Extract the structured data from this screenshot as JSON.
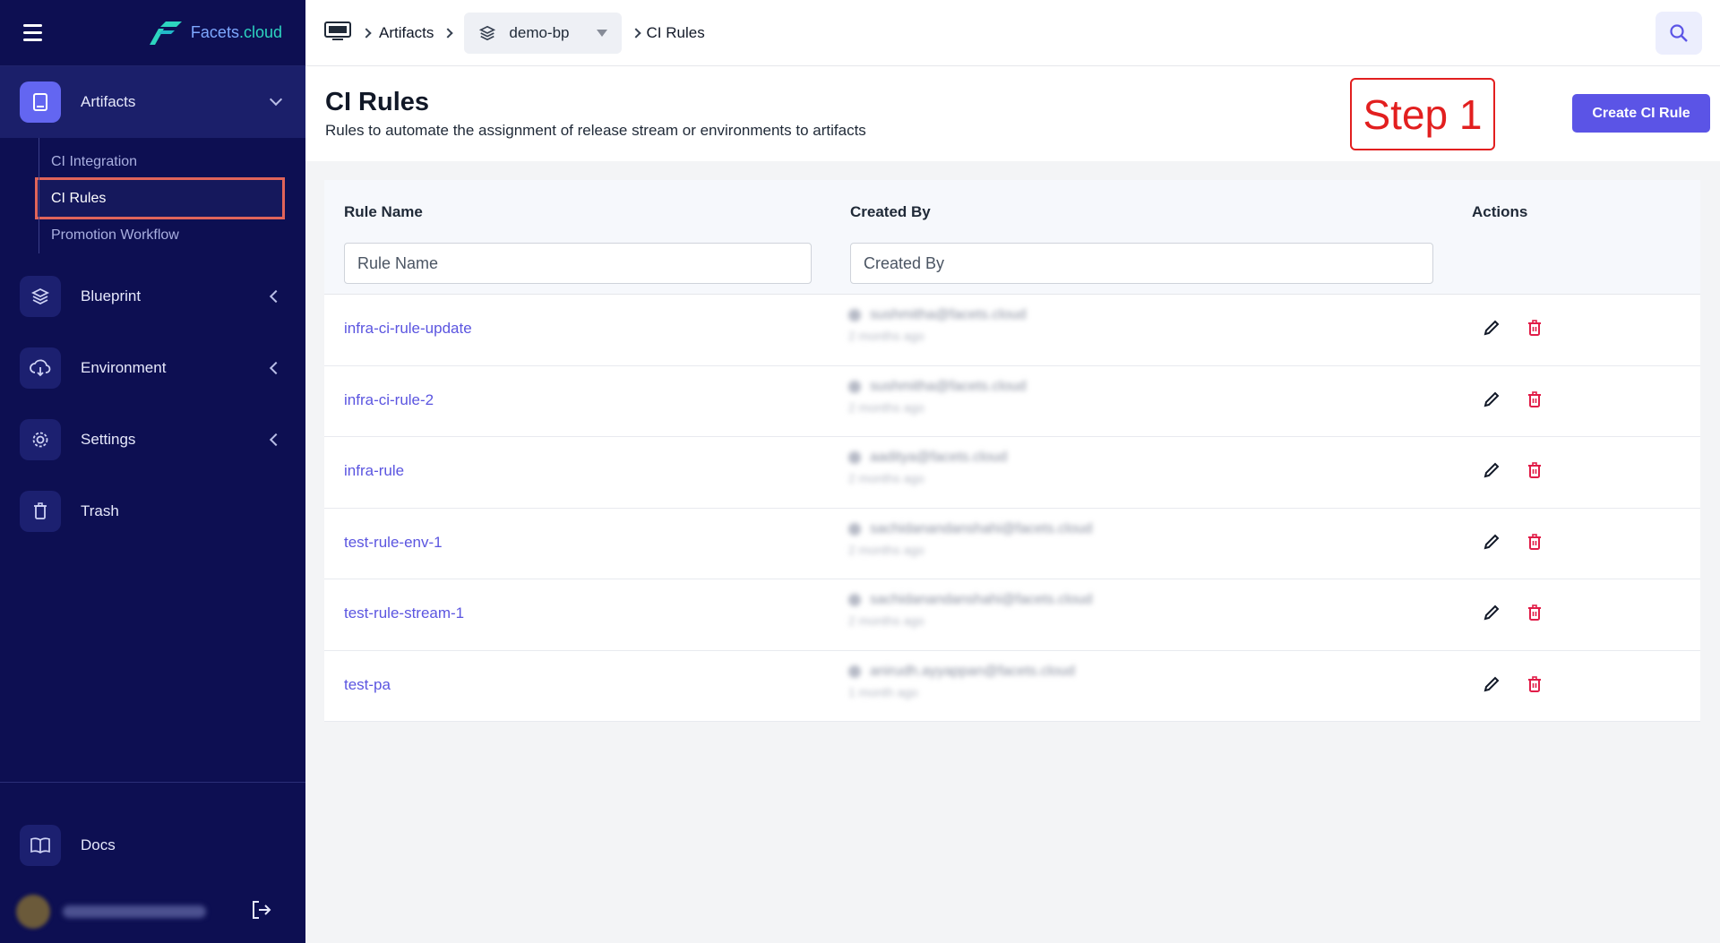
{
  "brand": {
    "name_main": "Facets",
    "name_suffix": ".cloud"
  },
  "sidebar": {
    "items": [
      {
        "label": "Artifacts",
        "icon": "book-icon",
        "expanded": true
      },
      {
        "label": "Blueprint",
        "icon": "layers-icon"
      },
      {
        "label": "Environment",
        "icon": "cloud-download-icon"
      },
      {
        "label": "Settings",
        "icon": "gear-icon"
      },
      {
        "label": "Trash",
        "icon": "trash-icon"
      }
    ],
    "artifacts_sub": [
      {
        "label": "CI Integration"
      },
      {
        "label": "CI Rules",
        "active": true
      },
      {
        "label": "Promotion Workflow"
      }
    ],
    "docs_label": "Docs",
    "user_name": "blurred-user-name"
  },
  "breadcrumb": {
    "root_icon": "demo-icon",
    "artifacts": "Artifacts",
    "blueprint": "demo-bp",
    "current": "CI Rules"
  },
  "page": {
    "title": "CI Rules",
    "subtitle": "Rules to automate the assignment of release stream or environments to artifacts",
    "step_annotation": "Step 1",
    "create_button": "Create CI Rule"
  },
  "table": {
    "headers": {
      "rule_name": "Rule Name",
      "created_by": "Created By",
      "actions": "Actions"
    },
    "filters": {
      "rule_name_placeholder": "Rule Name",
      "created_by_placeholder": "Created By"
    },
    "rows": [
      {
        "name": "infra-ci-rule-update",
        "creator": "sushmitha@facets.cloud",
        "time": "2 months ago"
      },
      {
        "name": "infra-ci-rule-2",
        "creator": "sushmitha@facets.cloud",
        "time": "2 months ago"
      },
      {
        "name": "infra-rule",
        "creator": "aaditya@facets.cloud",
        "time": "2 months ago"
      },
      {
        "name": "test-rule-env-1",
        "creator": "sachidanandanshahi@facets.cloud",
        "time": "2 months ago"
      },
      {
        "name": "test-rule-stream-1",
        "creator": "sachidanandanshahi@facets.cloud",
        "time": "2 months ago"
      },
      {
        "name": "test-pa",
        "creator": "anirudh.ayyappan@facets.cloud",
        "time": "1 month ago"
      }
    ]
  },
  "colors": {
    "sidebar_bg": "#0d0f52",
    "accent": "#5b54e6",
    "link": "#5b55e0",
    "danger": "#e11d48",
    "annotation": "#e21f1f"
  }
}
